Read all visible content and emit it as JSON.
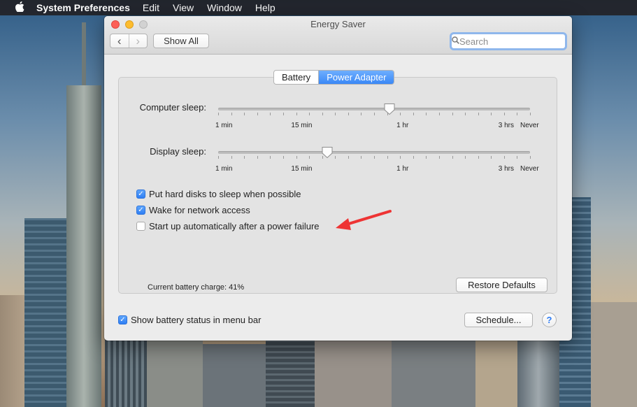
{
  "menubar": {
    "app_name": "System Preferences",
    "items": [
      "Edit",
      "View",
      "Window",
      "Help"
    ]
  },
  "window": {
    "title": "Energy Saver"
  },
  "toolbar": {
    "back_glyph": "‹",
    "forward_glyph": "›",
    "show_all_label": "Show All",
    "search_placeholder": "Search"
  },
  "tabs": [
    {
      "label": "Battery",
      "selected": false
    },
    {
      "label": "Power Adapter",
      "selected": true
    }
  ],
  "sliders": [
    {
      "label": "Computer sleep:",
      "tick_labels": [
        "1 min",
        "15 min",
        "1 hr",
        "3 hrs",
        "Never"
      ],
      "value_fraction": 0.55
    },
    {
      "label": "Display sleep:",
      "tick_labels": [
        "1 min",
        "15 min",
        "1 hr",
        "3 hrs",
        "Never"
      ],
      "value_fraction": 0.35
    }
  ],
  "options": [
    {
      "label": "Put hard disks to sleep when possible",
      "checked": true
    },
    {
      "label": "Wake for network access",
      "checked": true
    },
    {
      "label": "Start up automatically after a power failure",
      "checked": false
    }
  ],
  "status": {
    "battery_charge": "Current battery charge: 41%"
  },
  "buttons": {
    "restore_defaults": "Restore Defaults",
    "schedule": "Schedule...",
    "help": "?"
  },
  "footer_option": {
    "label": "Show battery status in menu bar",
    "checked": true
  },
  "colors": {
    "accent": "#3a88f6",
    "annotation_arrow": "#ee3434"
  },
  "icons": {
    "apple": "apple-logo-icon",
    "search": "magnifier-icon",
    "clear": "clear-x-icon",
    "annotation": "red-arrow-icon"
  }
}
